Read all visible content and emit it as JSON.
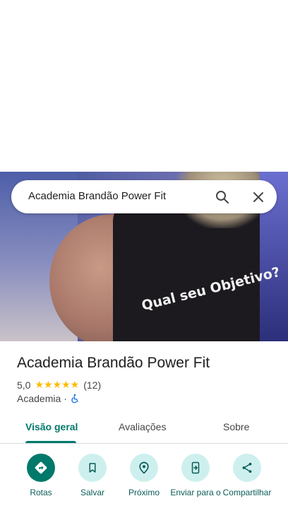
{
  "search": {
    "query": "Academia Brandão Power Fit"
  },
  "hero": {
    "shirt_text": "Qual seu Objetivo?"
  },
  "place": {
    "title": "Academia Brandão Power Fit",
    "rating": "5,0",
    "stars": "★★★★★",
    "review_count": "(12)",
    "category": "Academia",
    "separator": "·",
    "accessibility_icon": "wheelchair-icon"
  },
  "tabs": [
    {
      "label": "Visão geral",
      "active": true
    },
    {
      "label": "Avaliações",
      "active": false
    },
    {
      "label": "Sobre",
      "active": false
    }
  ],
  "actions": [
    {
      "label": "Rotas",
      "icon": "directions-icon"
    },
    {
      "label": "Salvar",
      "icon": "bookmark-icon"
    },
    {
      "label": "Próximo",
      "icon": "nearby-icon"
    },
    {
      "label": "Enviar para o",
      "icon": "send-to-phone-icon"
    },
    {
      "label": "Compartilhar",
      "icon": "share-icon"
    }
  ],
  "colors": {
    "accent": "#00796b",
    "action_bg": "#cdf0ee",
    "star": "#fbbc04"
  }
}
